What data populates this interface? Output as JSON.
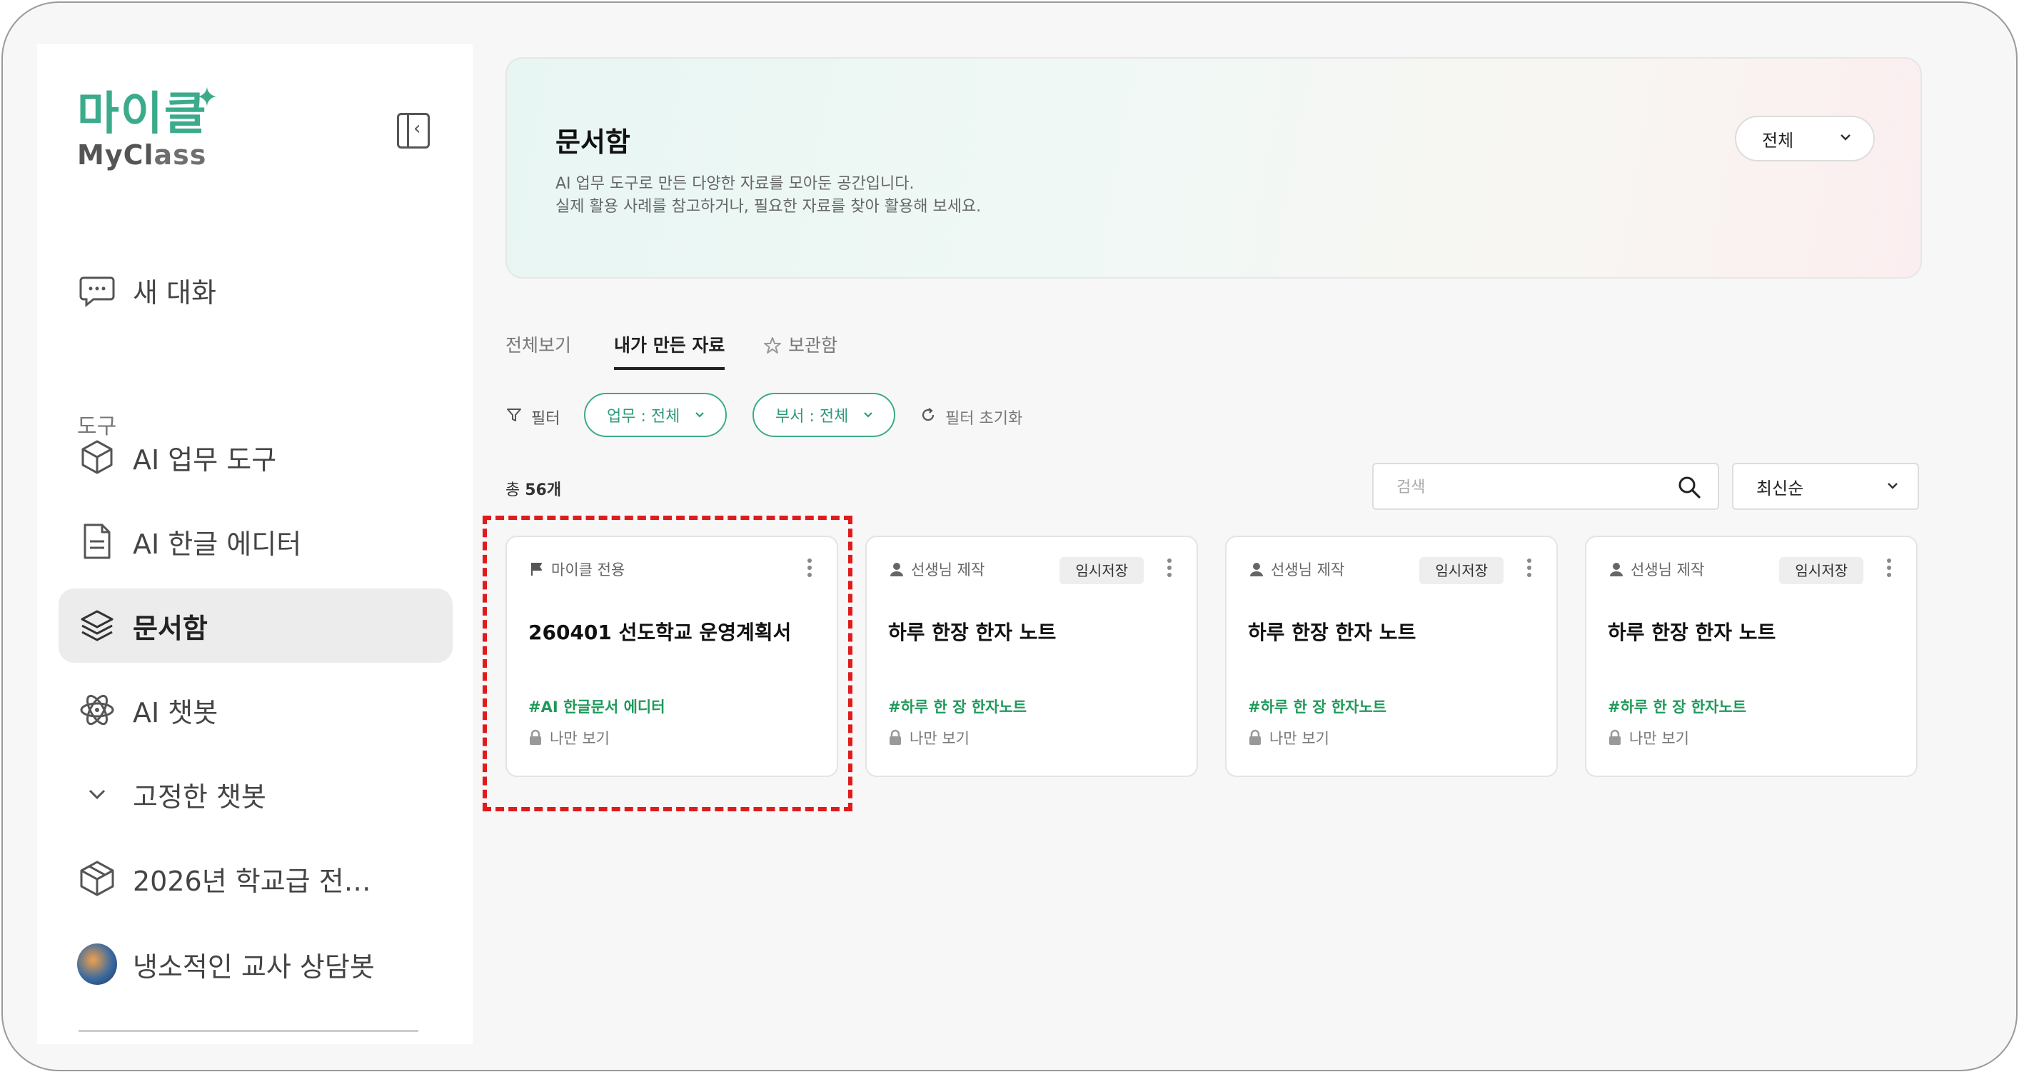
{
  "sidebar": {
    "logo_ko": "마이클",
    "logo_en_1": "MyCl",
    "logo_en_2": "ass",
    "new_chat": "새 대화",
    "section_tools": "도구",
    "items": [
      {
        "label": "AI 업무 도구",
        "icon": "cube-icon"
      },
      {
        "label": "AI 한글 에디터",
        "icon": "document-icon"
      },
      {
        "label": "문서함",
        "icon": "layers-icon",
        "active": true
      },
      {
        "label": "AI 챗봇",
        "icon": "atom-icon"
      }
    ],
    "pinned_label": "고정한 챗봇",
    "pinned": [
      {
        "label": "2026년 학교급 전…",
        "icon": "cube-outline-icon"
      },
      {
        "label": "냉소적인 교사 상담봇",
        "icon": "avatar"
      }
    ]
  },
  "banner": {
    "title": "문서함",
    "desc_line1": "AI 업무 도구로 만든 다양한 자료를 모아둔 공간입니다.",
    "desc_line2": "실제 활용 사례를 참고하거나, 필요한 자료를 찾아 활용해 보세요.",
    "scope_value": "전체"
  },
  "tabs": [
    {
      "label": "전체보기",
      "active": false
    },
    {
      "label": "내가 만든 자료",
      "active": true
    },
    {
      "label": "보관함",
      "active": false
    }
  ],
  "filters": {
    "label": "필터",
    "work": "업무 : 전체",
    "dept": "부서 : 전체",
    "reset": "필터 초기화"
  },
  "list": {
    "total_prefix": "총 ",
    "total_count": "56개",
    "search_placeholder": "검색",
    "sort_value": "최신순"
  },
  "cards": [
    {
      "owner": "마이클 전용",
      "owner_icon": "flag-icon",
      "badge": "",
      "title": "260401 선도학교 운영계획서",
      "tag": "#AI 한글문서 에디터",
      "visibility": "나만 보기"
    },
    {
      "owner": "선생님 제작",
      "owner_icon": "user-icon",
      "badge": "임시저장",
      "title": "하루 한장 한자 노트",
      "tag": "#하루 한 장 한자노트",
      "visibility": "나만 보기"
    },
    {
      "owner": "선생님 제작",
      "owner_icon": "user-icon",
      "badge": "임시저장",
      "title": "하루 한장 한자 노트",
      "tag": "#하루 한 장 한자노트",
      "visibility": "나만 보기"
    },
    {
      "owner": "선생님 제작",
      "owner_icon": "user-icon",
      "badge": "임시저장",
      "title": "하루 한장 한자 노트",
      "tag": "#하루 한 장 한자노트",
      "visibility": "나만 보기"
    }
  ],
  "colors": {
    "accent": "#3bab8c",
    "tag": "#1f9a5a",
    "highlight": "#e01b1b"
  }
}
